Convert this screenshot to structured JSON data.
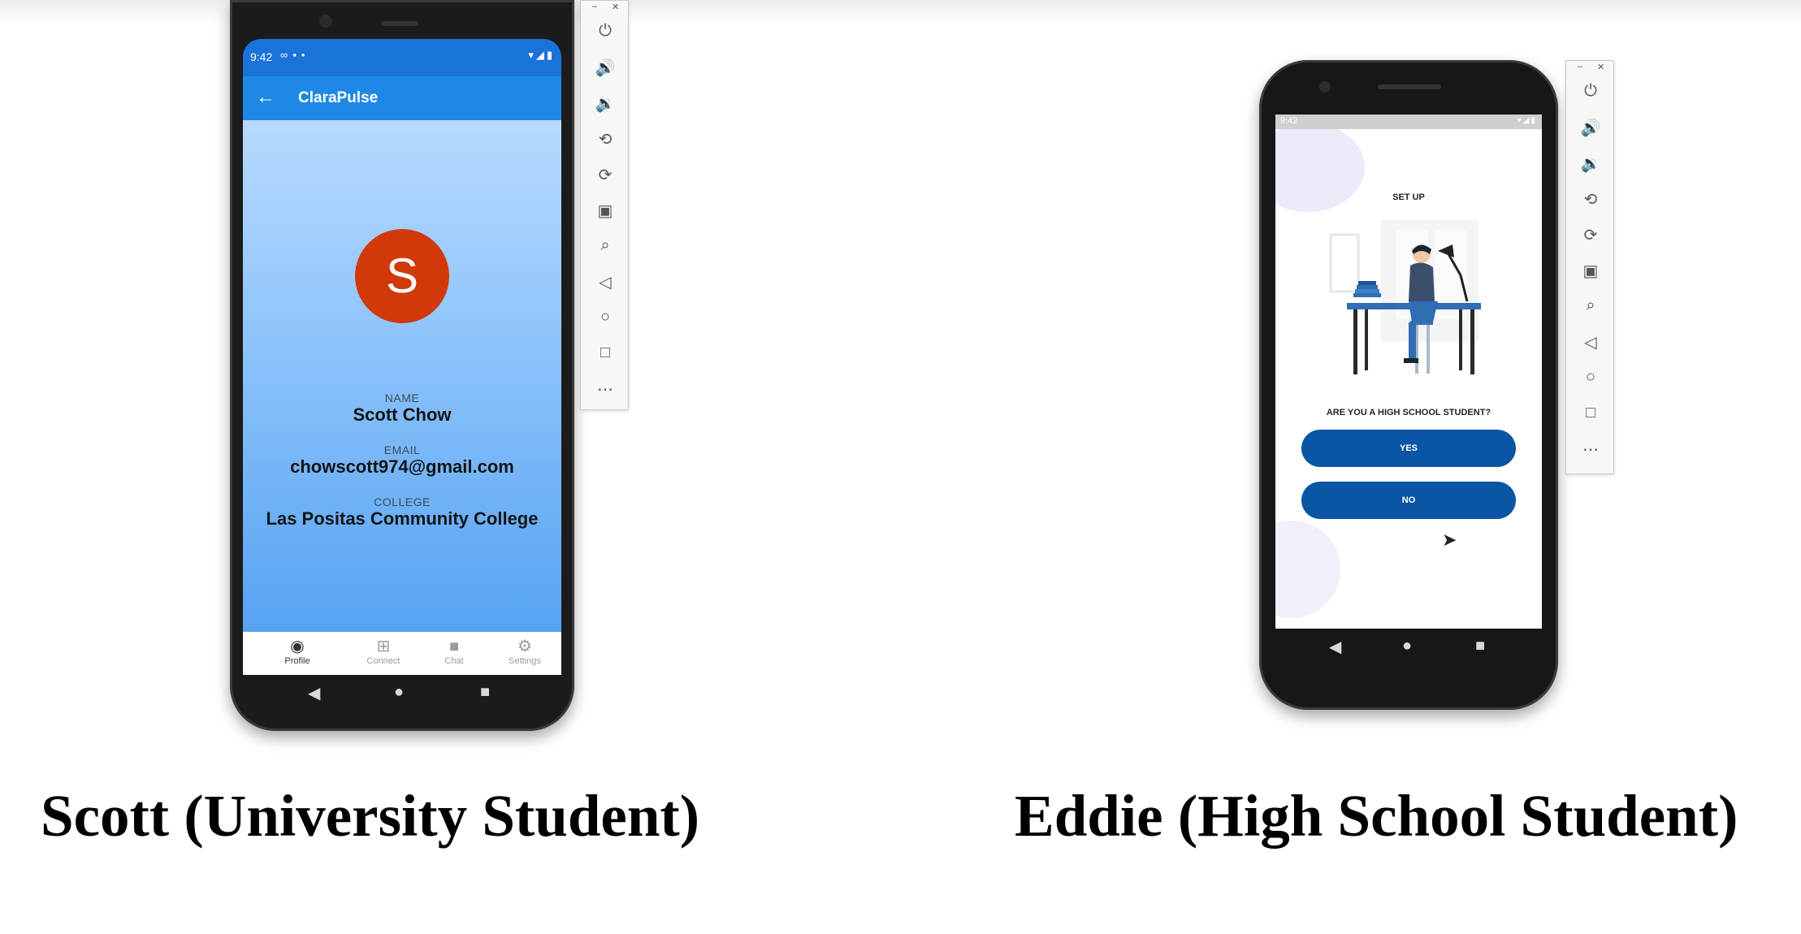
{
  "phone1": {
    "status_time": "9:42",
    "app_title": "ClaraPulse",
    "avatar_letter": "S",
    "avatar_color": "#d2390a",
    "name_label": "NAME",
    "name_value": "Scott Chow",
    "email_label": "EMAIL",
    "email_value": "chowscott974@gmail.com",
    "college_label": "COLLEGE",
    "college_value": "Las Positas Community College",
    "nav": [
      {
        "label": "Profile",
        "icon": "person-circle-icon"
      },
      {
        "label": "Connect",
        "icon": "add-box-icon"
      },
      {
        "label": "Chat",
        "icon": "video-camera-icon"
      },
      {
        "label": "Settings",
        "icon": "gear-icon"
      }
    ]
  },
  "phone2": {
    "status_time": "9:42",
    "setup_title": "SET UP",
    "question": "ARE YOU A HIGH SCHOOL STUDENT?",
    "yes_label": "YES",
    "no_label": "NO",
    "button_color": "#0b56a4"
  },
  "toolbar_icons": [
    "power-icon",
    "volume-up-icon",
    "volume-down-icon",
    "rotate-left-icon",
    "rotate-right-icon",
    "camera-icon",
    "zoom-icon",
    "back-icon",
    "home-icon",
    "overview-icon",
    "more-icon"
  ],
  "captions": {
    "left": "Scott (University Student)",
    "right": "Eddie (High School Student)"
  }
}
